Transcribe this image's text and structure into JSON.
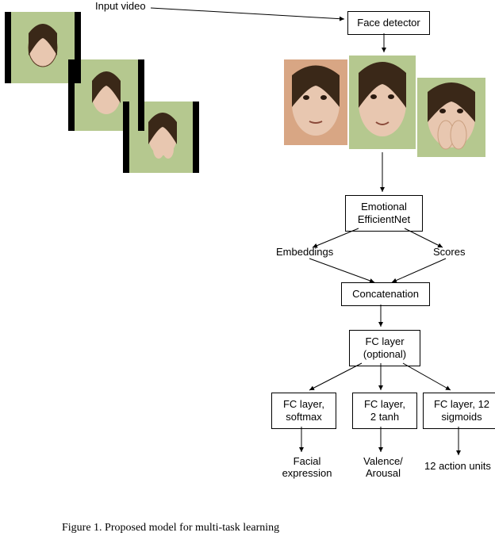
{
  "labels": {
    "input_video": "Input video",
    "embeddings": "Embeddings",
    "scores": "Scores"
  },
  "boxes": {
    "face_detector": "Face detector",
    "emo_net_l1": "Emotional",
    "emo_net_l2": "EfficientNet",
    "concatenation": "Concatenation",
    "fc_optional_l1": "FC layer",
    "fc_optional_l2": "(optional)",
    "fc_softmax_l1": "FC layer,",
    "fc_softmax_l2": "softmax",
    "fc_tanh_l1": "FC layer,",
    "fc_tanh_l2": "2 tanh",
    "fc_sigmoid_l1": "FC layer, 12",
    "fc_sigmoid_l2": "sigmoids"
  },
  "outputs": {
    "facial_l1": "Facial",
    "facial_l2": "expression",
    "valence_l1": "Valence/",
    "valence_l2": "Arousal",
    "au": "12 action units"
  },
  "caption": "Figure 1. Proposed model for multi-task learning"
}
